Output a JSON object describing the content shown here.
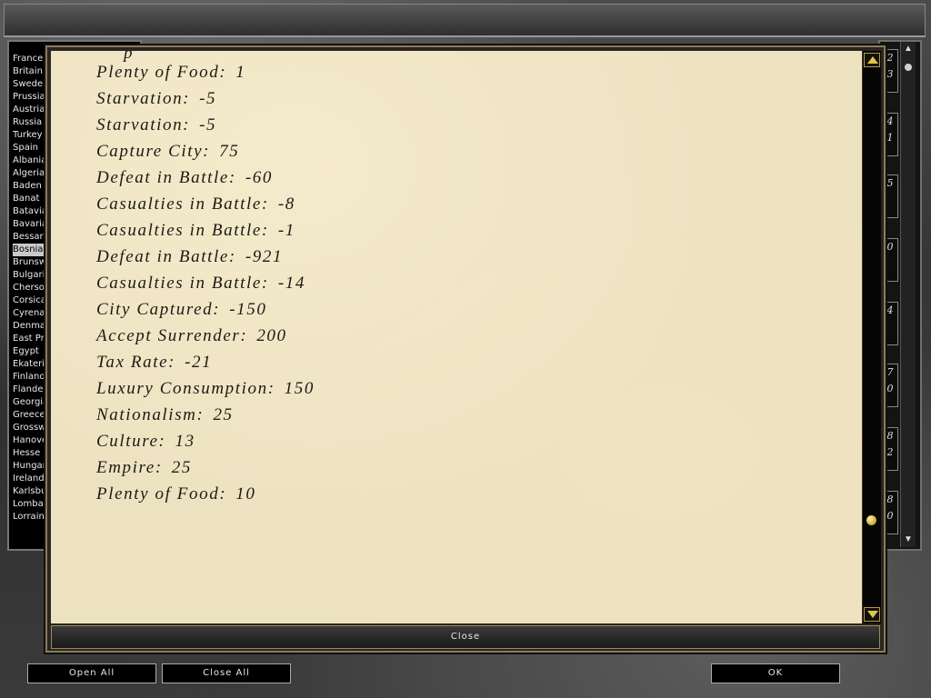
{
  "nations": [
    "France",
    "Britain",
    "Sweden",
    "Prussia",
    "Austria",
    "Russia",
    "Turkey",
    "Spain",
    "Albania",
    "Algeria",
    "Baden",
    "Banat",
    "Batavia",
    "Bavaria",
    "Bessarabia",
    "Bosnia",
    "Brunswick",
    "Bulgaria",
    "Cherson",
    "Corsica",
    "Cyrenaica",
    "Denmark",
    "East Prussia",
    "Egypt",
    "Ekaterinoslav",
    "Finland",
    "Flanders",
    "Georgia",
    "Greece",
    "Grosswardein",
    "Hanover",
    "Hesse",
    "Hungary",
    "Ireland",
    "Karlsburg",
    "Lombardy",
    "Lorraine"
  ],
  "selected_nation": "Bosnia",
  "right_digits": [
    [
      "2",
      "3"
    ],
    [
      "4",
      "1"
    ],
    [
      "5",
      ""
    ],
    [
      "0",
      ""
    ],
    [
      "4",
      ""
    ],
    [
      "7",
      "0"
    ],
    [
      "8",
      "2"
    ],
    [
      "8",
      "0"
    ]
  ],
  "log_cutoff": "p",
  "log_entries": [
    {
      "label": "Plenty of Food:",
      "value": "1"
    },
    {
      "label": "Starvation:",
      "value": "-5"
    },
    {
      "label": "Starvation:",
      "value": "-5"
    },
    {
      "label": "Capture City:",
      "value": "75"
    },
    {
      "label": "Defeat in Battle:",
      "value": "-60"
    },
    {
      "label": "Casualties in Battle:",
      "value": "-8"
    },
    {
      "label": "Casualties in Battle:",
      "value": "-1"
    },
    {
      "label": "Defeat in Battle:",
      "value": "-921"
    },
    {
      "label": "Casualties in Battle:",
      "value": "-14"
    },
    {
      "label": "City Captured:",
      "value": "-150"
    },
    {
      "label": "Accept Surrender:",
      "value": "200"
    },
    {
      "label": "Tax Rate:",
      "value": "-21"
    },
    {
      "label": "Luxury Consumption:",
      "value": "150"
    },
    {
      "label": "Nationalism:",
      "value": "25"
    },
    {
      "label": "Culture:",
      "value": "13"
    },
    {
      "label": "Empire:",
      "value": "25"
    },
    {
      "label": "Plenty of Food:",
      "value": "10"
    }
  ],
  "dialog": {
    "close_label": "Close"
  },
  "buttons": {
    "open_all": "Open All",
    "close_all": "Close All",
    "ok": "OK"
  },
  "scroll": {
    "position_fraction": 0.84
  }
}
